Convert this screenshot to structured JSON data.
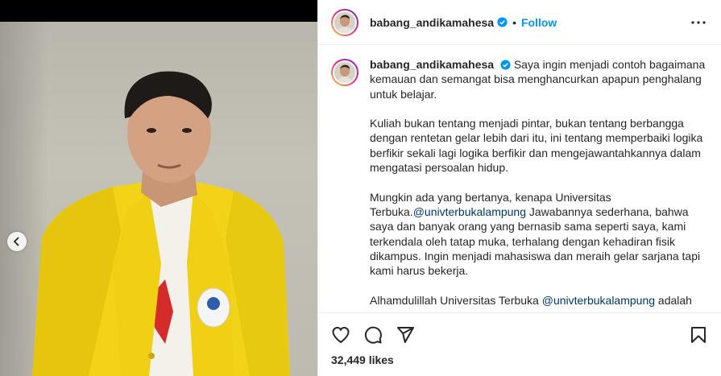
{
  "post": {
    "username": "babang_andikamahesa",
    "follow_label": "Follow",
    "separator": "•",
    "likes": "32,449 likes"
  },
  "caption": {
    "username": "babang_andikamahesa",
    "p1": "Saya ingin menjadi contoh bagaimana kemauan dan semangat bisa menghancurkan apapun penghalang untuk belajar.",
    "p2": "Kuliah bukan tentang menjadi pintar, bukan tentang berbangga dengan rentetan gelar lebih dari itu, ini tentang memperbaiki logika berfikir sekali lagi logika berfikir dan mengejawantahkannya dalam mengatasi persoalan hidup.",
    "p3_start": "Mungkin ada yang bertanya, kenapa Universitas Terbuka.",
    "mention": "@univterbukalampung",
    "p3_end": " Jawabannya sederhana, bahwa saya dan banyak orang yang bernasib sama seperti saya, kami terkendala oleh tatap muka, terhalang dengan kehadiran fisik dikampus. Ingin menjadi mahasiswa dan meraih gelar sarjana tapi kami harus bekerja.",
    "p4_start": "Alhamdulillah Universitas Terbuka ",
    "p4_mention": "@univterbukalampung",
    "p4_end": " adalah"
  },
  "icons": {
    "verified": "verified-badge-icon",
    "more": "more-options-icon",
    "like": "heart-icon",
    "comment": "comment-icon",
    "share": "share-icon",
    "save": "bookmark-icon",
    "prev": "chevron-left-icon"
  },
  "colors": {
    "accent": "#0095f6",
    "mention": "#00376b",
    "jacket": "#f0d21c"
  }
}
